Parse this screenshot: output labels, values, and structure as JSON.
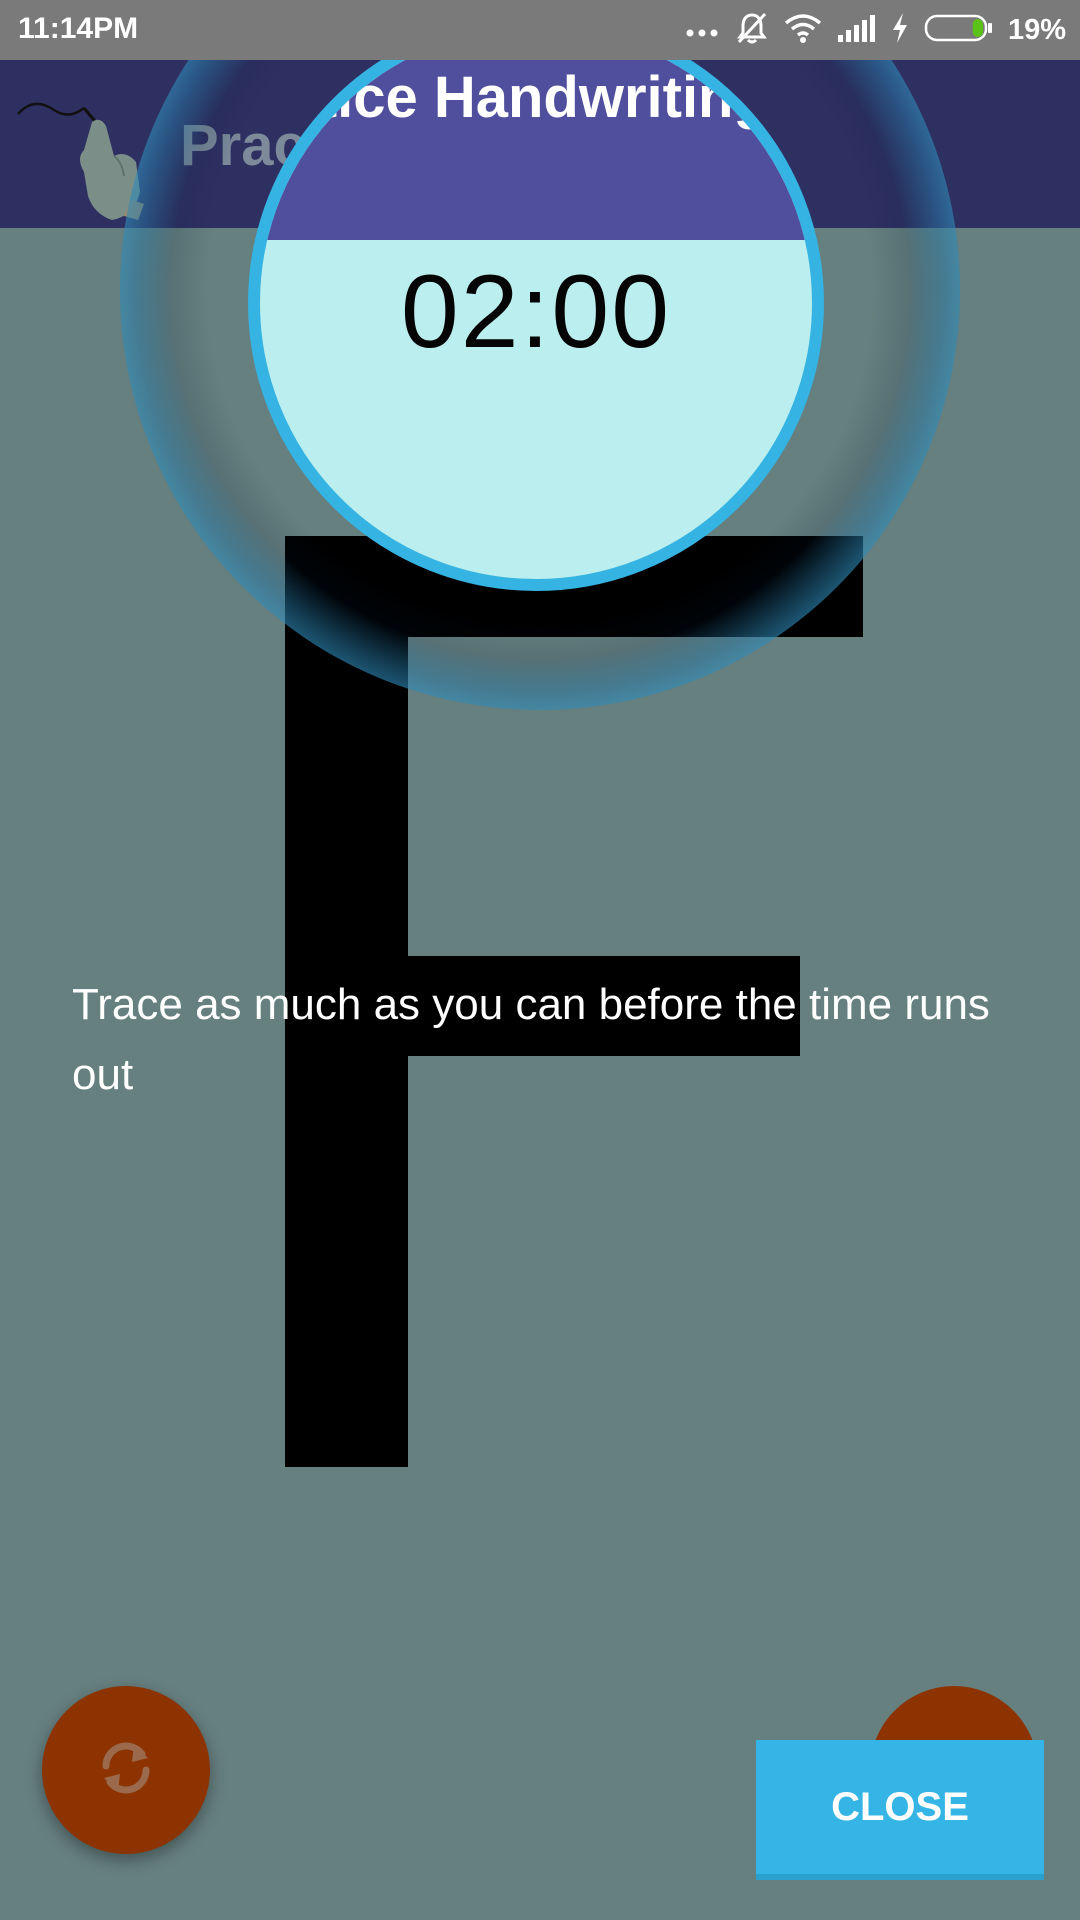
{
  "status_bar": {
    "time": "11:14PM",
    "battery_percent": "19%",
    "battery_level": 0.19,
    "icons": [
      "more-dots-icon",
      "silent-bell-icon",
      "wifi-icon",
      "signal-icon",
      "charging-icon",
      "battery-icon"
    ]
  },
  "app_bar": {
    "title": "Practice Handwriting",
    "logo_icon": "hand-stylus-icon"
  },
  "timer": {
    "value": "02:00"
  },
  "tracing": {
    "letter": "F"
  },
  "instruction": {
    "text": "Trace as much as you can before the time runs out"
  },
  "actions": {
    "refresh_icon": "refresh-icon",
    "close_label": "CLOSE"
  },
  "colors": {
    "background": "#667f7f",
    "app_bar": "#2f3062",
    "highlight_ring": "#35b3e3",
    "spotlight_fill": "#bbeeee",
    "fab": "#8c3300",
    "close_button": "#35b5e5"
  }
}
